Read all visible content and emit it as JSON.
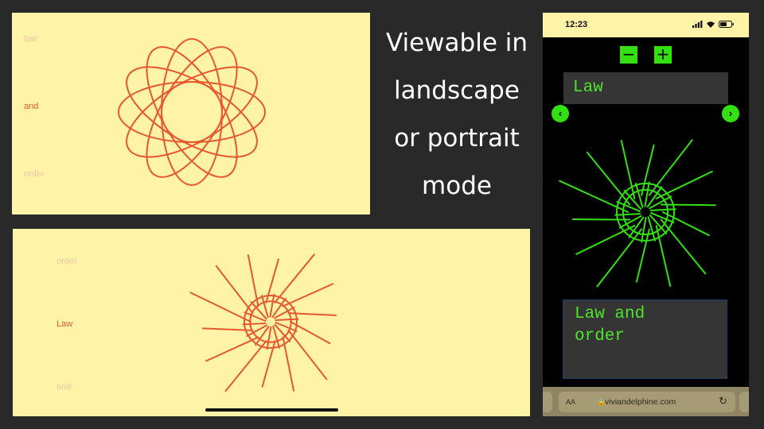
{
  "landscape_top": {
    "words": [
      "law",
      "and",
      "order"
    ],
    "active_word": "and"
  },
  "landscape_bottom": {
    "words": [
      "order",
      "Law",
      "and"
    ],
    "active_word": "Law"
  },
  "caption": {
    "lines": [
      "Viewable in",
      "landscape",
      "or portrait",
      "mode"
    ]
  },
  "phone": {
    "status_time": "12:23",
    "zoom_out_label": "−",
    "zoom_in_label": "+",
    "current_word": "Law",
    "prev_icon": "chevron-left-icon",
    "next_icon": "chevron-right-icon",
    "phrase_lines": [
      "Law and",
      "order"
    ],
    "browser": {
      "text_size_label": "AA",
      "url": "viviandelphine.com"
    }
  },
  "colors": {
    "background": "#292929",
    "panel": "#fff3a8",
    "orange_stroke": "#e8582f",
    "faded_word": "#f6c6a0",
    "neon_green": "#33e010"
  }
}
